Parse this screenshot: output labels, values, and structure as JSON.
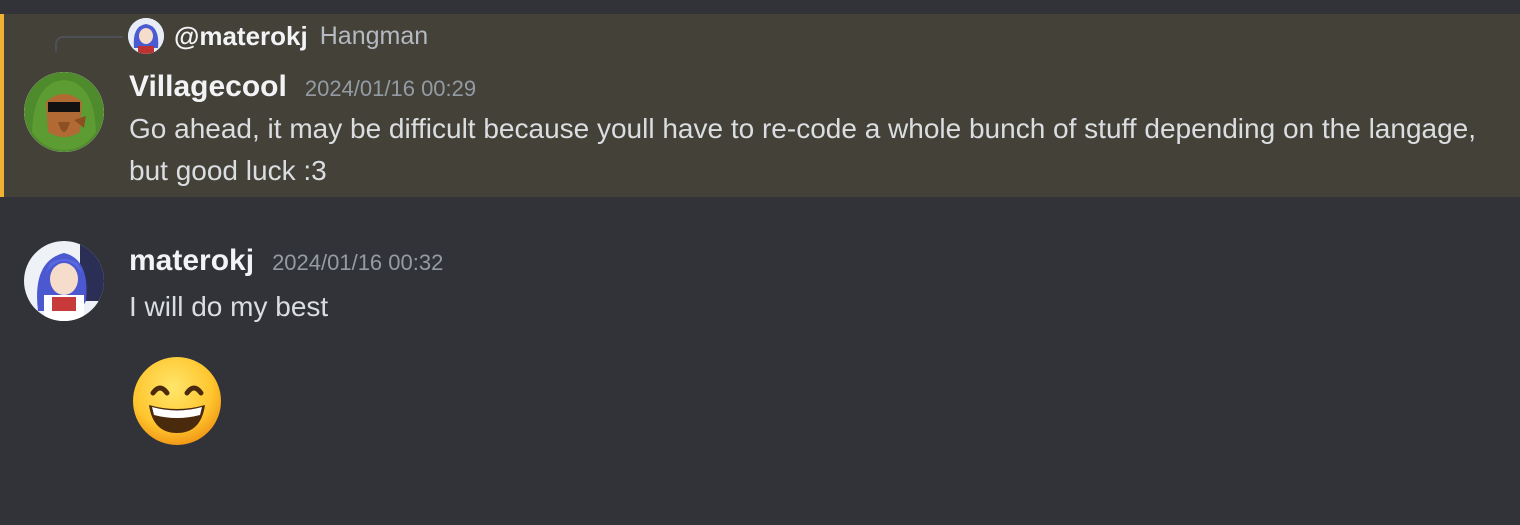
{
  "reply": {
    "author": "@materokj",
    "preview": "Hangman"
  },
  "messages": [
    {
      "author": "Villagecool",
      "timestamp": "2024/01/16 00:29",
      "text": "Go ahead, it may be difficult because youll have to re-code a whole bunch of stuff depending on the langage, but good luck :3",
      "avatar_icon": "green-frog-hood-avatar",
      "highlighted": true
    },
    {
      "author": "materokj",
      "timestamp": "2024/01/16 00:32",
      "text": "I will do my best",
      "avatar_icon": "anime-blue-hair-avatar",
      "emoji_icon": "grinning-face-with-smiling-eyes"
    }
  ],
  "colors": {
    "background": "#313338",
    "highlight_background": "#444139",
    "highlight_bar": "#f0b232",
    "username": "#f2f3f5",
    "timestamp": "#949ba4",
    "text": "#dbdee1"
  }
}
